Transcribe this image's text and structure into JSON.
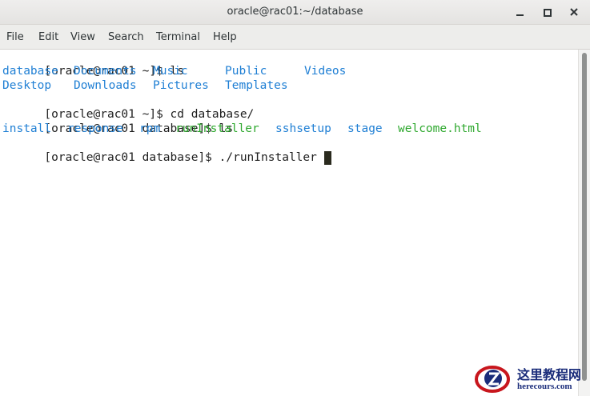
{
  "window": {
    "title": "oracle@rac01:~/database"
  },
  "menu": [
    "File",
    "Edit",
    "View",
    "Search",
    "Terminal",
    "Help"
  ],
  "terminal": {
    "lines": [
      {
        "prompt": "[oracle@rac01 ~]$ ",
        "command": "ls"
      },
      {
        "items": [
          {
            "text": "database",
            "kind": "dir"
          },
          {
            "text": "Documents",
            "kind": "dir"
          },
          {
            "text": "Music",
            "kind": "dir"
          },
          {
            "text": "Public",
            "kind": "dir"
          },
          {
            "text": "Videos",
            "kind": "dir"
          }
        ]
      },
      {
        "items": [
          {
            "text": "Desktop",
            "kind": "dir"
          },
          {
            "text": "Downloads",
            "kind": "dir"
          },
          {
            "text": "Pictures",
            "kind": "dir"
          },
          {
            "text": "Templates",
            "kind": "dir"
          }
        ]
      },
      {
        "prompt": "[oracle@rac01 ~]$ ",
        "command": "cd database/"
      },
      {
        "prompt": "[oracle@rac01 database]$ ",
        "command": "ls"
      },
      {
        "items": [
          {
            "text": "install",
            "kind": "dir"
          },
          {
            "text": "response",
            "kind": "dir"
          },
          {
            "text": "rpm",
            "kind": "dir"
          },
          {
            "text": "runInstaller",
            "kind": "exe"
          },
          {
            "text": "sshsetup",
            "kind": "dir"
          },
          {
            "text": "stage",
            "kind": "dir"
          },
          {
            "text": "welcome.html",
            "kind": "exe"
          }
        ]
      },
      {
        "prompt": "[oracle@rac01 database]$ ",
        "command": "./runInstaller ",
        "cursor": true
      }
    ]
  },
  "watermark": {
    "title": "这里教程网",
    "url": "herecours.com"
  },
  "colors": {
    "directory": "#1f7fd4",
    "executable": "#2ea82e",
    "text": "#1e1e1e",
    "titlebar": "#e8e7e5"
  }
}
